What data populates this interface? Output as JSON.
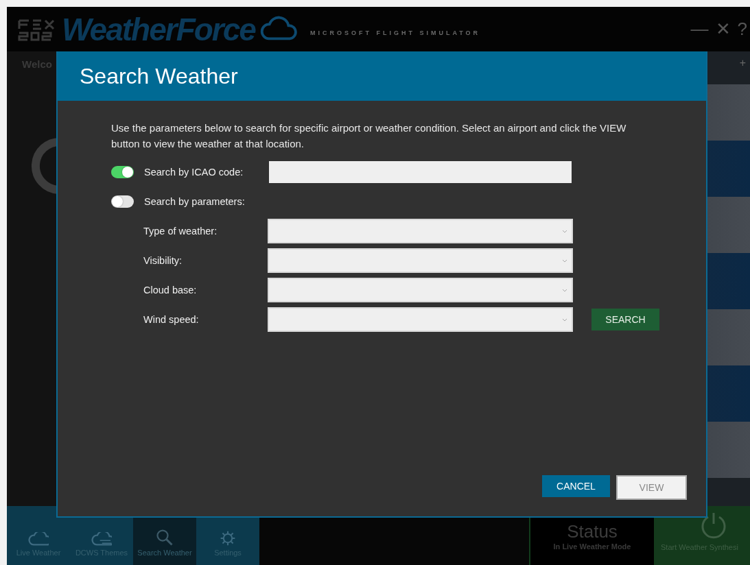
{
  "app": {
    "title": "WeatherForce",
    "subtitle": "MICROSOFT FLIGHT SIMULATOR",
    "window_controls": [
      "—",
      "✕",
      "?"
    ],
    "welcome": "Welco",
    "add": "+"
  },
  "nav": [
    {
      "label": "Live Weather",
      "selected": false
    },
    {
      "label": "DCWS Themes",
      "selected": false
    },
    {
      "label": "Search Weather",
      "selected": true
    },
    {
      "label": "Settings",
      "selected": false
    }
  ],
  "status": {
    "title": "Status",
    "subtitle": "In Live Weather Mode"
  },
  "synthesis_button": "Start Weather Synthesi",
  "dialog": {
    "title": "Search Weather",
    "intro": "Use the parameters below to search for specific airport or weather condition. Select an airport and click the VIEW button to view the weather at that location.",
    "toggles": [
      {
        "label": "Search by ICAO code:",
        "on": true
      },
      {
        "label": "Search by parameters:",
        "on": false
      }
    ],
    "dropdowns": [
      {
        "label": "Type of weather:"
      },
      {
        "label": "Visibility:"
      },
      {
        "label": "Cloud base:"
      },
      {
        "label": "Wind speed:"
      }
    ],
    "search_button": "SEARCH",
    "cancel_button": "CANCEL",
    "view_button": {
      "label": "VIEW",
      "disabled": true
    }
  }
}
